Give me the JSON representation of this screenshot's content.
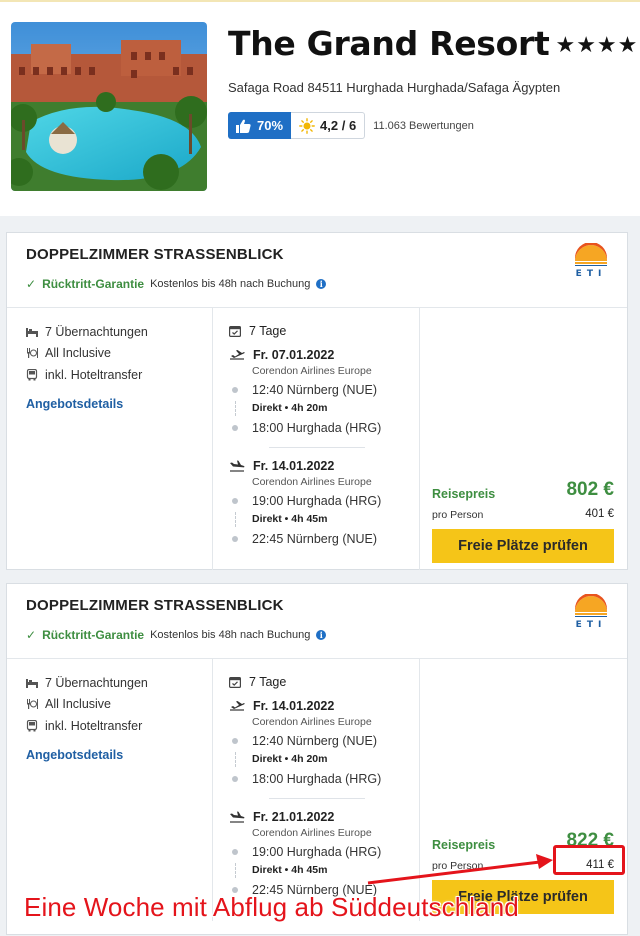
{
  "hotel": {
    "name": "The Grand Resort",
    "stars": "★★★★",
    "address": "Safaga Road 84511 Hurghada Hurghada/Safaga Ägypten",
    "recommendation": "70%",
    "score": "4,2 / 6",
    "reviews": "11.063 Bewertungen"
  },
  "offers": [
    {
      "title": "DOPPELZIMMER STRASSENBLICK",
      "guarantee_label": "Rücktritt-Garantie",
      "guarantee_note": "Kostenlos bis 48h nach Buchung",
      "operator": "ETI",
      "features": [
        "7 Übernachtungen",
        "All Inclusive",
        "inkl. Hoteltransfer"
      ],
      "details_link": "Angebotsdetails",
      "duration": "7 Tage",
      "outbound": {
        "date": "Fr. 07.01.2022",
        "airline": "Corendon Airlines Europe",
        "dep": "12:40 Nürnberg (NUE)",
        "direct": "Direkt  •  4h 20m",
        "arr": "18:00 Hurghada (HRG)"
      },
      "return": {
        "date": "Fr. 14.01.2022",
        "airline": "Corendon Airlines Europe",
        "dep": "19:00 Hurghada (HRG)",
        "direct": "Direkt  •  4h 45m",
        "arr": "22:45 Nürnberg (NUE)"
      },
      "price_label": "Reisepreis",
      "price_total": "802 €",
      "per_person_label": "pro Person",
      "per_person_price": "401 €",
      "button_label": "Freie Plätze prüfen"
    },
    {
      "title": "DOPPELZIMMER STRASSENBLICK",
      "guarantee_label": "Rücktritt-Garantie",
      "guarantee_note": "Kostenlos bis 48h nach Buchung",
      "operator": "ETI",
      "features": [
        "7 Übernachtungen",
        "All Inclusive",
        "inkl. Hoteltransfer"
      ],
      "details_link": "Angebotsdetails",
      "duration": "7 Tage",
      "outbound": {
        "date": "Fr. 14.01.2022",
        "airline": "Corendon Airlines Europe",
        "dep": "12:40 Nürnberg (NUE)",
        "direct": "Direkt  •  4h 20m",
        "arr": "18:00 Hurghada (HRG)"
      },
      "return": {
        "date": "Fr. 21.01.2022",
        "airline": "Corendon Airlines Europe",
        "dep": "19:00 Hurghada (HRG)",
        "direct": "Direkt  •  4h 45m",
        "arr": "22:45 Nürnberg (NUE)"
      },
      "price_label": "Reisepreis",
      "price_total": "822 €",
      "per_person_label": "pro Person",
      "per_person_price": "411 €",
      "button_label": "Freie Plätze prüfen"
    }
  ],
  "annotation": {
    "text": "Eine Woche mit Abflug ab Süddeutschland",
    "color": "#e4141b"
  },
  "colors": {
    "accent_blue": "#1f6fc5",
    "price_green": "#3e8e41",
    "button_yellow": "#f5c518"
  }
}
